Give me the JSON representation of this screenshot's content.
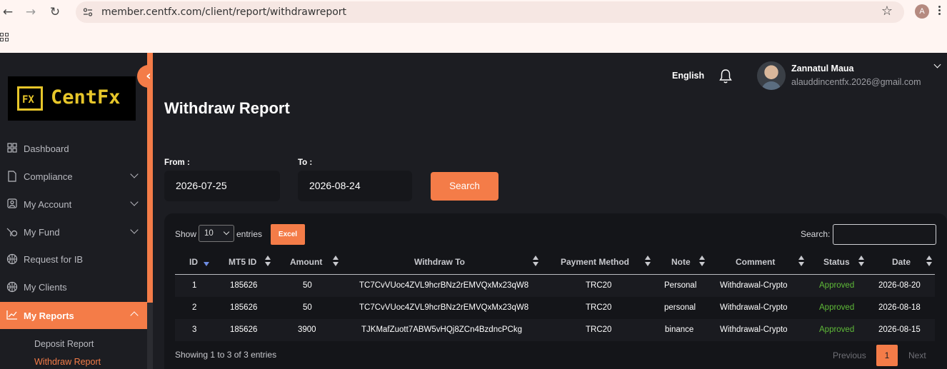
{
  "browser": {
    "back_icon": "arrow-left-icon",
    "url": "member.centfx.com/client/report/withdrawreport",
    "profile_initial": "A"
  },
  "sidebar": {
    "logo_mark": "FX",
    "logo_text": "CentFx",
    "items": [
      {
        "label": "Dashboard",
        "icon": "grid-icon"
      },
      {
        "label": "Compliance",
        "icon": "document-icon"
      },
      {
        "label": "My Account",
        "icon": "user-icon"
      },
      {
        "label": "My Fund",
        "icon": "fund-icon"
      },
      {
        "label": "Request for IB",
        "icon": "basketball-icon"
      },
      {
        "label": "My Clients",
        "icon": "basketball-icon"
      },
      {
        "label": "My Reports",
        "icon": "chart-icon"
      }
    ],
    "sub_items": [
      "Deposit Report",
      "Withdraw Report"
    ]
  },
  "topbar": {
    "language": "English",
    "user_name": "Zannatul Maua",
    "user_email": "alauddincentfx.2026@gmail.com"
  },
  "page": {
    "title": "Withdraw Report",
    "from_label": "From :",
    "from_value": "2026-07-25",
    "to_label": "To :",
    "to_value": "2026-08-24",
    "search_button": "Search"
  },
  "table": {
    "show_label": "Show",
    "page_length": "10",
    "entries_label": "entries",
    "excel_button": "Excel",
    "search_label": "Search:",
    "columns": [
      "ID",
      "MT5 ID",
      "Amount",
      "Withdraw To",
      "Payment Method",
      "Note",
      "Comment",
      "Status",
      "Date"
    ],
    "rows": [
      [
        "1",
        "185626",
        "50",
        "TC7CvVUoc4ZVL9hcrBNz2rEMVQxMx23qW8",
        "TRC20",
        "Personal",
        "Withdrawal-Crypto",
        "Approved",
        "2026-08-20"
      ],
      [
        "2",
        "185626",
        "50",
        "TC7CvVUoc4ZVL9hcrBNz2rEMVQxMx23qW8",
        "TRC20",
        "personal",
        "Withdrawal-Crypto",
        "Approved",
        "2026-08-18"
      ],
      [
        "3",
        "185626",
        "3900",
        "TJKMafZuott7ABW5vHQj8ZCn4BzdncPCkg",
        "TRC20",
        "binance",
        "Withdrawal-Crypto",
        "Approved",
        "2026-08-15"
      ]
    ],
    "info": "Showing 1 to 3 of 3 entries",
    "previous": "Previous",
    "current_page": "1",
    "next": "Next"
  },
  "colors": {
    "accent": "#f47c48",
    "background": "#1c1d22",
    "approved": "#5fbb38"
  }
}
